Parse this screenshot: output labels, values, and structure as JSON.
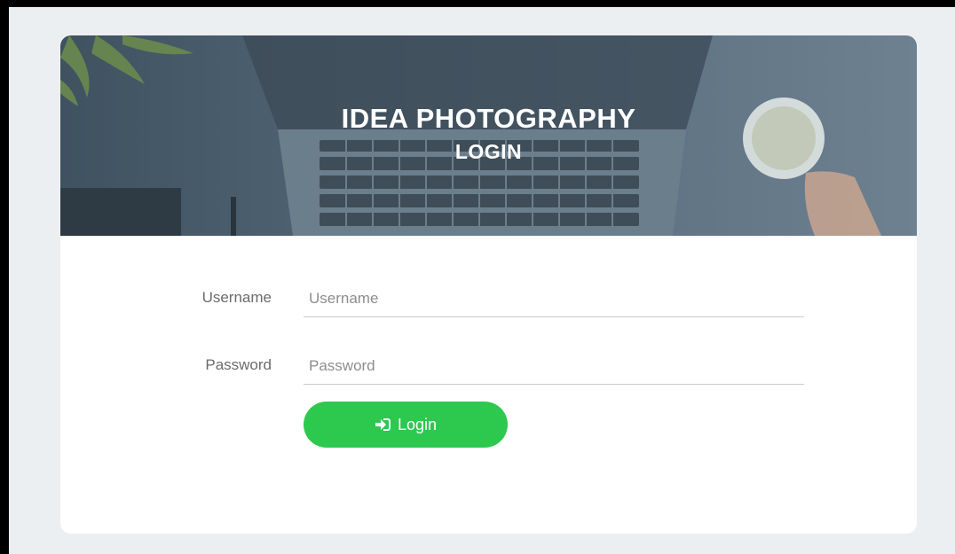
{
  "header": {
    "title": "IDEA PHOTOGRAPHY",
    "subtitle": "LOGIN"
  },
  "form": {
    "username_label": "Username",
    "username_placeholder": "Username",
    "username_value": "",
    "password_label": "Password",
    "password_placeholder": "Password",
    "password_value": "",
    "login_label": "Login",
    "login_icon": "sign-in-icon"
  },
  "colors": {
    "button": "#2dc94f",
    "background": "#eceff1",
    "header_overlay": "#4f6372"
  }
}
